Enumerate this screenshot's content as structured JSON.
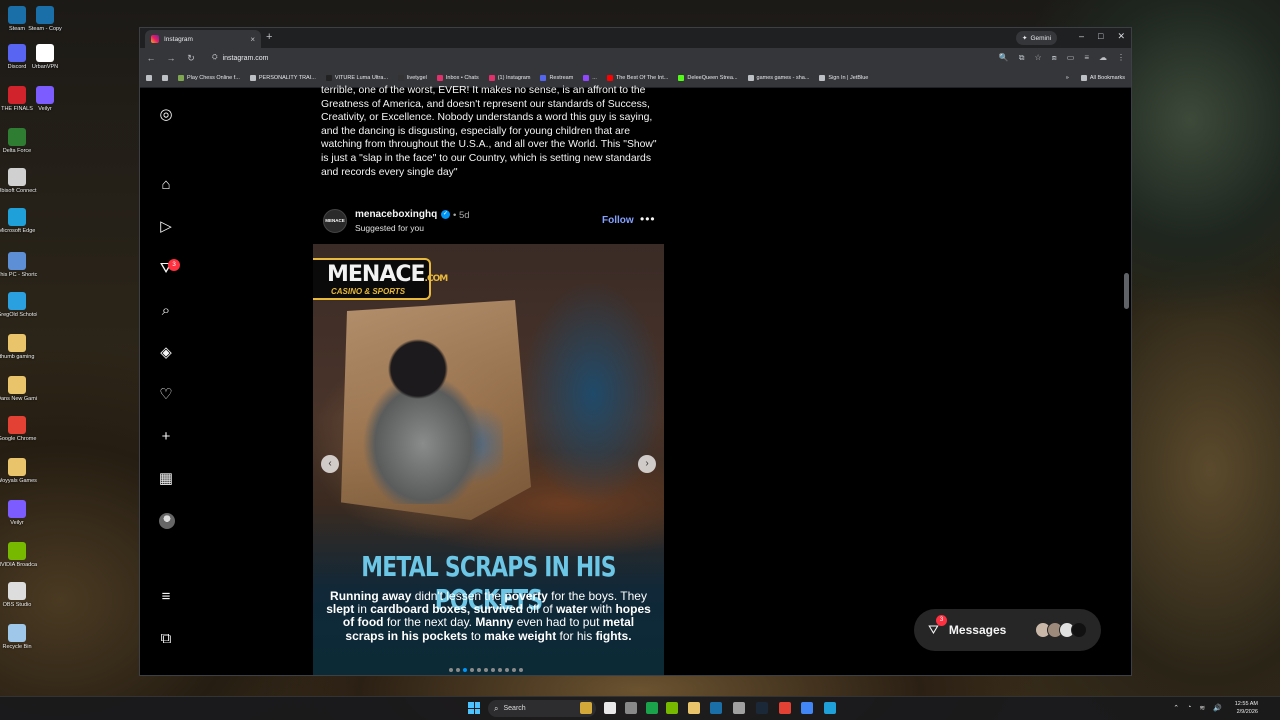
{
  "desktop": {
    "icons": [
      {
        "label": "Steam",
        "color": "#1b6fa8"
      },
      {
        "label": "Steam - Copy",
        "color": "#1b6fa8"
      },
      {
        "label": "Discord",
        "color": "#5865f2"
      },
      {
        "label": "UrbanVPN",
        "color": "#ffffff"
      },
      {
        "label": "THE FINALS",
        "color": "#d0232b"
      },
      {
        "label": "Veilyr",
        "color": "#7c5cff"
      },
      {
        "label": "Delta Force",
        "color": "#2e7d32"
      },
      {
        "label": "Ubisoft Connect",
        "color": "#d0d0d0"
      },
      {
        "label": "Microsoft Edge",
        "color": "#1fa0d8"
      },
      {
        "label": "This PC - Shortcut",
        "color": "#5c8fd6"
      },
      {
        "label": "GregOld Schotol Run...",
        "color": "#2aa0e0"
      },
      {
        "label": "thumb gaming",
        "color": "#e9c46a"
      },
      {
        "label": "Dans New Gaming PICS",
        "color": "#e9c46a"
      },
      {
        "label": "Google Chrome",
        "color": "#e34133"
      },
      {
        "label": "Woyyals Games a...",
        "color": "#e9c46a"
      },
      {
        "label": "Veilyr",
        "color": "#7c5cff"
      },
      {
        "label": "NVIDIA Broadcast",
        "color": "#76b900"
      },
      {
        "label": "OBS Studio",
        "color": "#dddddd"
      },
      {
        "label": "Recycle Bin",
        "color": "#9ec7ea"
      }
    ]
  },
  "browser": {
    "tab_title": "Instagram",
    "tab_close": "×",
    "new_tab": "+",
    "gemini_label": "Gemini",
    "gemini_icon": "✦",
    "window_controls": {
      "minimize": "–",
      "maximize": "□",
      "close": "✕"
    },
    "nav": {
      "back": "←",
      "forward": "→",
      "reload": "↻"
    },
    "url": "instagram.com",
    "site_info_icon": "⛭",
    "addr_icons": [
      "🔍",
      "⧉",
      "☆",
      "⧈",
      "▭",
      "≡",
      "☁",
      "⋮"
    ],
    "bookmarks": [
      {
        "label": "",
        "color": "#bdc1c6"
      },
      {
        "label": "",
        "color": "#bdc1c6"
      },
      {
        "label": "Play Chess Online f...",
        "color": "#7fa650"
      },
      {
        "label": "PERSONALITY TRAI...",
        "color": "#bdc1c6"
      },
      {
        "label": "VITURE Luma Ultra...",
        "color": "#222222"
      },
      {
        "label": "livetygel",
        "color": "#333333"
      },
      {
        "label": "Inbox • Chats",
        "color": "#e1306c"
      },
      {
        "label": "(1) Instagram",
        "color": "#e1306c"
      },
      {
        "label": "Restream",
        "color": "#5566ee"
      },
      {
        "label": "...",
        "color": "#9146ff"
      },
      {
        "label": "The Best Of The Int...",
        "color": "#ff0000"
      },
      {
        "label": "DeleeQueen Strea...",
        "color": "#53fc18"
      },
      {
        "label": "games games - sha...",
        "color": "#bdc1c6"
      },
      {
        "label": "Sign In | JetBlue",
        "color": "#bdc1c6"
      }
    ],
    "bookmarks_more": "»",
    "all_bookmarks": "All Bookmarks"
  },
  "instagram": {
    "sidebar": {
      "instagram_glyph": "◎",
      "home_glyph": "⌂",
      "reels_glyph": "▷",
      "messages_glyph": "⛛",
      "search_glyph": "⌕",
      "explore_glyph": "◈",
      "notifications_glyph": "♡",
      "create_glyph": "+",
      "dashboard_glyph": "▦",
      "more_glyph": "≡",
      "also_glyph": "⧉",
      "messages_badge": "3"
    },
    "caption_text": "terrible, one of the worst, EVER! It makes no sense, is an affront to the Greatness of America, and doesn't represent our standards of Success, Creativity, or Excellence. Nobody understands a word this guy is saying, and the dancing is disgusting, especially for young children that are watching from throughout the U.S.A., and all over the World. This \"Show\" is just a \"slap in the face\" to our Country, which is setting new standards and records every single day\"",
    "post": {
      "avatar_text": "MENACE",
      "username": "menaceboxinghq",
      "verified_glyph": "✓",
      "age": "• 5d",
      "subtitle": "Suggested for you",
      "follow_label": "Follow",
      "more_glyph": "•••",
      "image": {
        "logo_main": "MENACE",
        "logo_dot": ".COM",
        "logo_sub": "CASINO & SPORTS",
        "headline": "METAL SCRAPS IN HIS POCKETS",
        "body_segments": [
          {
            "t": "Running away",
            "b": true
          },
          {
            "t": " didn't lessen the ",
            "b": false
          },
          {
            "t": "poverty",
            "b": true
          },
          {
            "t": " for the boys. They ",
            "b": false
          },
          {
            "t": "slept",
            "b": true
          },
          {
            "t": " in ",
            "b": false
          },
          {
            "t": "cardboard boxes, survived",
            "b": true
          },
          {
            "t": " off of ",
            "b": false
          },
          {
            "t": "water",
            "b": true
          },
          {
            "t": " with ",
            "b": false
          },
          {
            "t": "hopes of food",
            "b": true
          },
          {
            "t": " for the next day. ",
            "b": false
          },
          {
            "t": "Manny",
            "b": true
          },
          {
            "t": " even had to put ",
            "b": false
          },
          {
            "t": "metal scraps in his pockets",
            "b": true
          },
          {
            "t": " to ",
            "b": false
          },
          {
            "t": "make weight",
            "b": true
          },
          {
            "t": " for his ",
            "b": false
          },
          {
            "t": "fights.",
            "b": true
          }
        ],
        "prev_glyph": "‹",
        "next_glyph": "›",
        "dot_count": 11,
        "active_dot": 2
      }
    },
    "messages": {
      "label": "Messages",
      "glyph": "⛛",
      "badge": "3",
      "avatar_colors": [
        "#c9b8a8",
        "#9e8a7a",
        "#e0e0e0",
        "#111111"
      ]
    }
  },
  "taskbar": {
    "search_label": "Search",
    "search_glyph": "⌕",
    "apps": [
      {
        "color": "#e8e8e8"
      },
      {
        "color": "#d4a93a"
      },
      {
        "color": "#888888"
      },
      {
        "color": "#1aa34a"
      },
      {
        "color": "#76b900"
      },
      {
        "color": "#e9c46a"
      },
      {
        "color": "#1b6fa8"
      },
      {
        "color": "#a0a0a0"
      },
      {
        "color": "#1b2838"
      },
      {
        "color": "#e34133"
      },
      {
        "color": "#4285f4"
      },
      {
        "color": "#1fa0d8"
      }
    ],
    "tray_icons": [
      "⌃",
      "◔",
      "≋",
      "🔊"
    ],
    "time": "12:55 AM",
    "date": "2/9/2026"
  }
}
